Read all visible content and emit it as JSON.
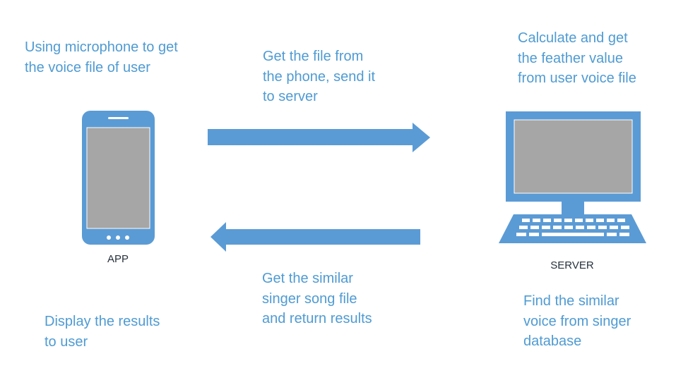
{
  "diagram": {
    "accent_color": "#5b9bd5",
    "screen_color": "#a6a6a6",
    "nodes": {
      "app": {
        "label": "APP",
        "icon": "smartphone-icon"
      },
      "server": {
        "label": "SERVER",
        "icon": "desktop-computer-icon"
      }
    },
    "notes": {
      "app_record": "Using microphone to get\nthe voice file of user",
      "send_file": "Get the file from\nthe phone, send it\nto server",
      "server_calc": "Calculate and get\nthe feather value\nfrom user voice file",
      "return_results": "Get the similar\nsinger song file\nand return results",
      "server_find": "Find the similar\nvoice from singer\ndatabase",
      "app_display": "Display the results\nto user"
    },
    "arrows": [
      {
        "from": "app",
        "to": "server",
        "icon": "arrow-right-icon"
      },
      {
        "from": "server",
        "to": "app",
        "icon": "arrow-left-icon"
      }
    ]
  }
}
